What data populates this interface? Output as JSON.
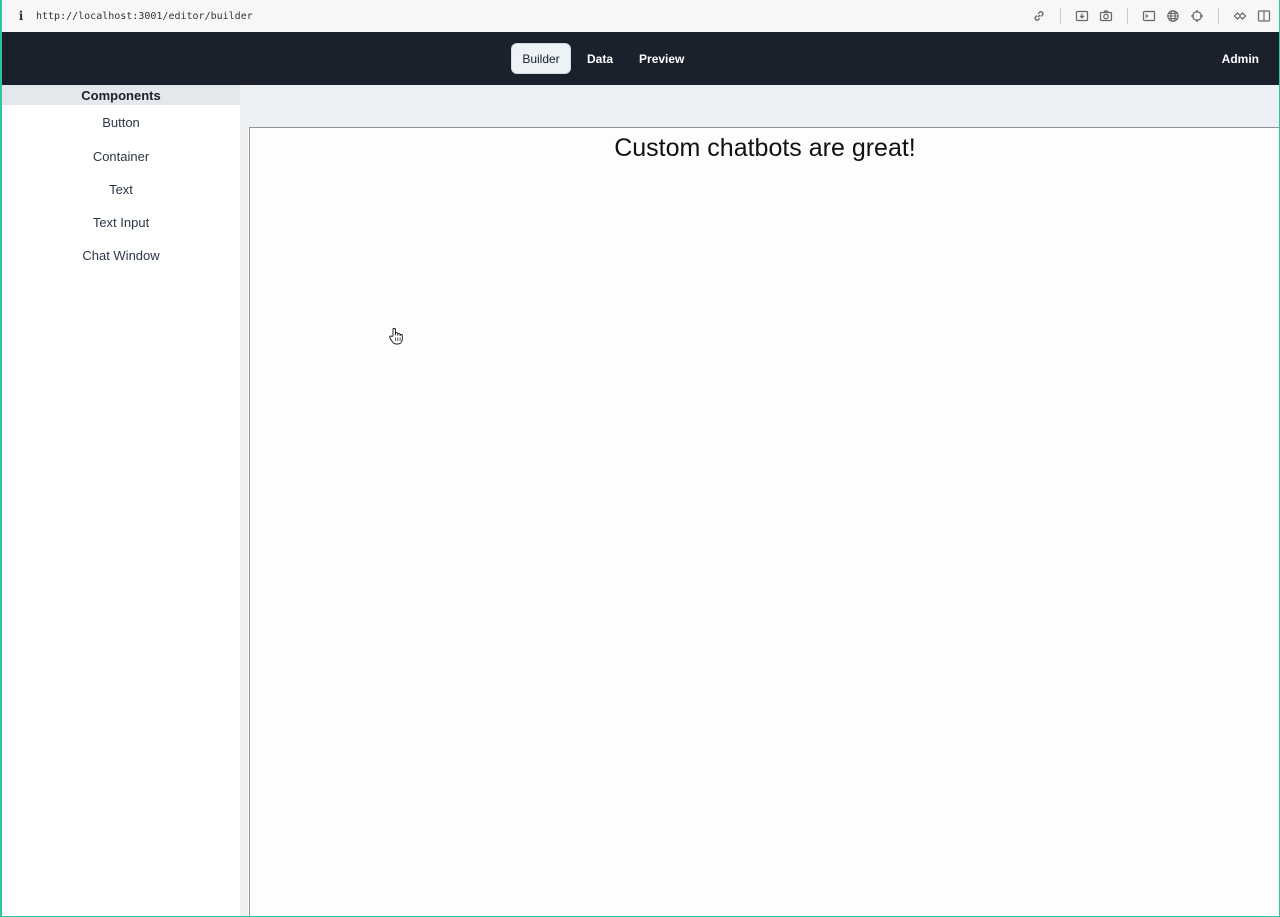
{
  "browser": {
    "url": "http://localhost:3001/editor/builder",
    "info_icon": "i",
    "tools": [
      "link-icon",
      "download-icon",
      "camera-icon",
      "terminal-icon",
      "globe-icon",
      "crosshair-icon",
      "extensions-icon",
      "sidebar-icon"
    ]
  },
  "header": {
    "tabs": [
      {
        "label": "Builder",
        "active": true
      },
      {
        "label": "Data",
        "active": false
      },
      {
        "label": "Preview",
        "active": false
      }
    ],
    "user_label": "Admin",
    "background": "#1a202c"
  },
  "sidebar": {
    "title": "Components",
    "items": [
      "Button",
      "Container",
      "Text",
      "Text Input",
      "Chat Window"
    ]
  },
  "canvas": {
    "heading": "Custom chatbots are great!"
  },
  "cursor": "hand-pointer-icon"
}
